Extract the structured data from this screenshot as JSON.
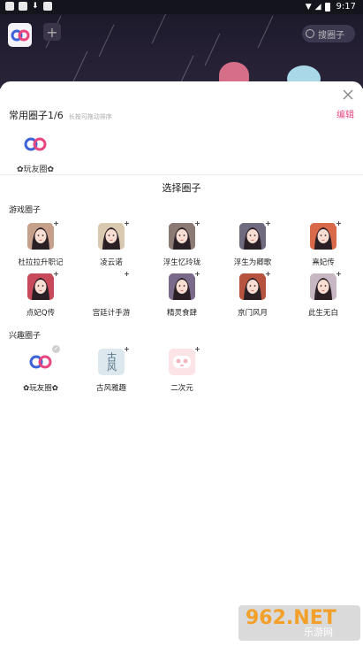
{
  "statusbar": {
    "time": "9:17"
  },
  "top": {
    "search_placeholder": "搜圈子"
  },
  "sheet": {
    "common": {
      "title": "常用圈子1/6",
      "hint": "长按可拖动排序",
      "edit_label": "编辑",
      "items": [
        {
          "label": "✿玩友圈✿"
        }
      ]
    },
    "choose_title": "选择圈子",
    "game_group": {
      "title": "游戏圈子",
      "rows": [
        [
          {
            "label": "杜拉拉升职记",
            "avatar": "girl",
            "color": "#c7a08c"
          },
          {
            "label": "凌云诺",
            "avatar": "girl",
            "color": "#d8c9b0"
          },
          {
            "label": "浮生忆玲珑",
            "avatar": "girl",
            "color": "#8b7a74"
          },
          {
            "label": "浮生为卿歌",
            "avatar": "girl",
            "color": "#6f6a7d"
          },
          {
            "label": "熹妃传",
            "avatar": "girl",
            "color": "#d86a4a"
          }
        ],
        [
          {
            "label": "点妃Q传",
            "avatar": "girl",
            "color": "#c84a5a"
          },
          {
            "label": "宫廷计手游",
            "avatar": "none",
            "color": "#ffffff"
          },
          {
            "label": "精灵食肆",
            "avatar": "girl",
            "color": "#7a6a8a"
          },
          {
            "label": "京门风月",
            "avatar": "girl",
            "color": "#b5533f"
          },
          {
            "label": "此生无白",
            "avatar": "girl",
            "color": "#c6b7c2"
          }
        ]
      ]
    },
    "interest_group": {
      "title": "兴趣圈子",
      "items": [
        {
          "label": "✿玩友圈✿",
          "avatar": "logo",
          "badge": "check"
        },
        {
          "label": "古风雅趣",
          "avatar": "text",
          "glyph": "古风",
          "badge": "plus"
        },
        {
          "label": "二次元",
          "avatar": "panda",
          "badge": "plus"
        }
      ]
    }
  },
  "watermark": {
    "logo": "962.NET",
    "sub": "乐游网"
  },
  "colors": {
    "accent": "#e64b84",
    "logo_blue": "#3e63d9",
    "logo_pink": "#e8467f"
  }
}
